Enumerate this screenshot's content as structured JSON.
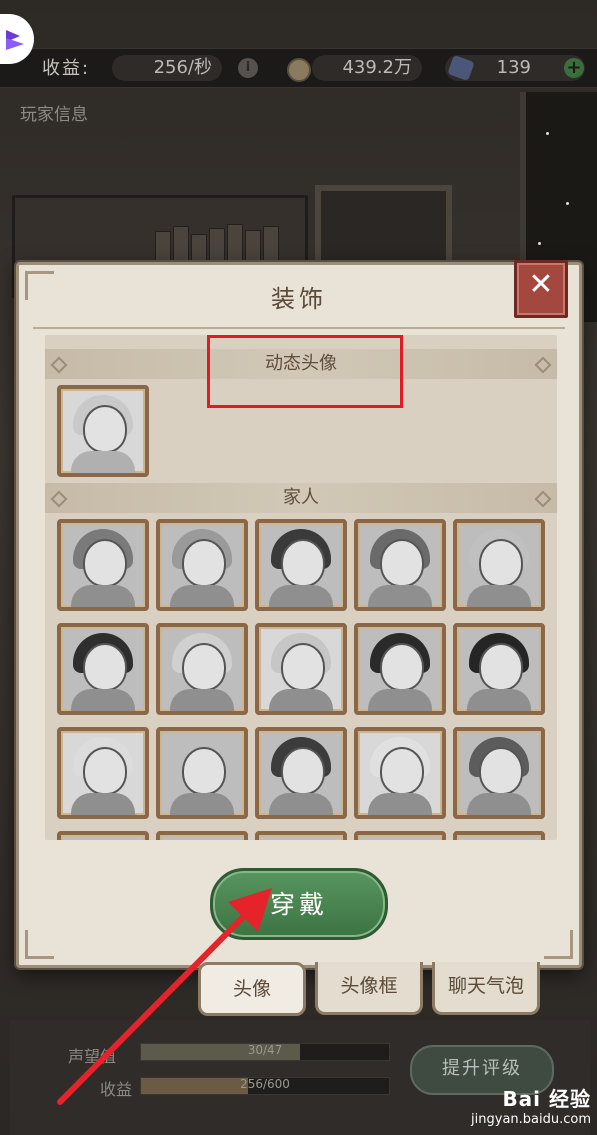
{
  "topbar": {
    "income_label": "收益:",
    "income_value": "256/秒",
    "coins_value": "439.2万",
    "gems_value": "139",
    "plus_icon": "plus-icon",
    "info_icon": "info-icon"
  },
  "player_info_label": "玩家信息",
  "dialog": {
    "title": "装饰",
    "close_icon": "close-icon",
    "sections": [
      {
        "title": "动态头像",
        "count": 1
      },
      {
        "title": "家人",
        "count": 20
      }
    ],
    "wear_label": "穿戴"
  },
  "tabs": [
    {
      "label": "头像",
      "active": true
    },
    {
      "label": "头像框",
      "active": false
    },
    {
      "label": "聊天气泡",
      "active": false
    }
  ],
  "bottom": {
    "reputation_label": "声望值",
    "reputation_value": "30/47",
    "reputation_progress": 0.64,
    "income_label": "收益",
    "income_value": "256/600",
    "income_progress": 0.43,
    "upgrade_label": "提升评级"
  },
  "watermark": {
    "brand": "Bai 经验",
    "url": "jingyan.baidu.com"
  },
  "colors": {
    "highlight_red": "#e01b24",
    "wear_green": "#3c7443",
    "close_red": "#a2483e",
    "dialog_bg": "#e9e3d7"
  }
}
